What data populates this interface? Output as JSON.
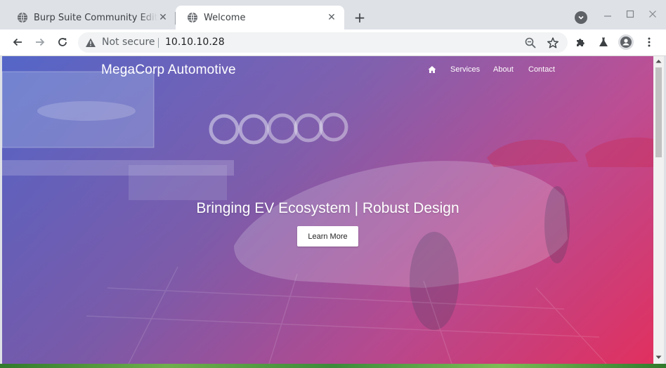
{
  "browser": {
    "tabs": [
      {
        "title": "Burp Suite Community Edition",
        "active": false,
        "icon": "globe-icon"
      },
      {
        "title": "Welcome",
        "active": true,
        "icon": "globe-icon"
      }
    ],
    "new_tab_label": "+",
    "close_glyph": "✕",
    "address_bar": {
      "security_label": "Not secure",
      "url": "10.10.10.28"
    },
    "toolbar_icons": [
      "back-icon",
      "forward-icon",
      "reload-icon",
      "zoom-icon",
      "star-icon",
      "extensions-icon",
      "labs-icon",
      "profile-icon",
      "menu-icon"
    ],
    "window_controls": [
      "minimize-icon",
      "maximize-icon",
      "close-icon"
    ]
  },
  "page": {
    "brand": "MegaCorp Automotive",
    "nav": {
      "home_icon": "home-icon",
      "links": [
        "Services",
        "About",
        "Contact"
      ]
    },
    "hero": {
      "heading": "Bringing EV Ecosystem | Robust Design",
      "button_label": "Learn More"
    }
  },
  "colors": {
    "gradient_start": "#465ac8",
    "gradient_mid": "#7850aa",
    "gradient_end": "#e8285a",
    "tab_strip": "#dee1e6",
    "button_bg": "#ffffff"
  }
}
